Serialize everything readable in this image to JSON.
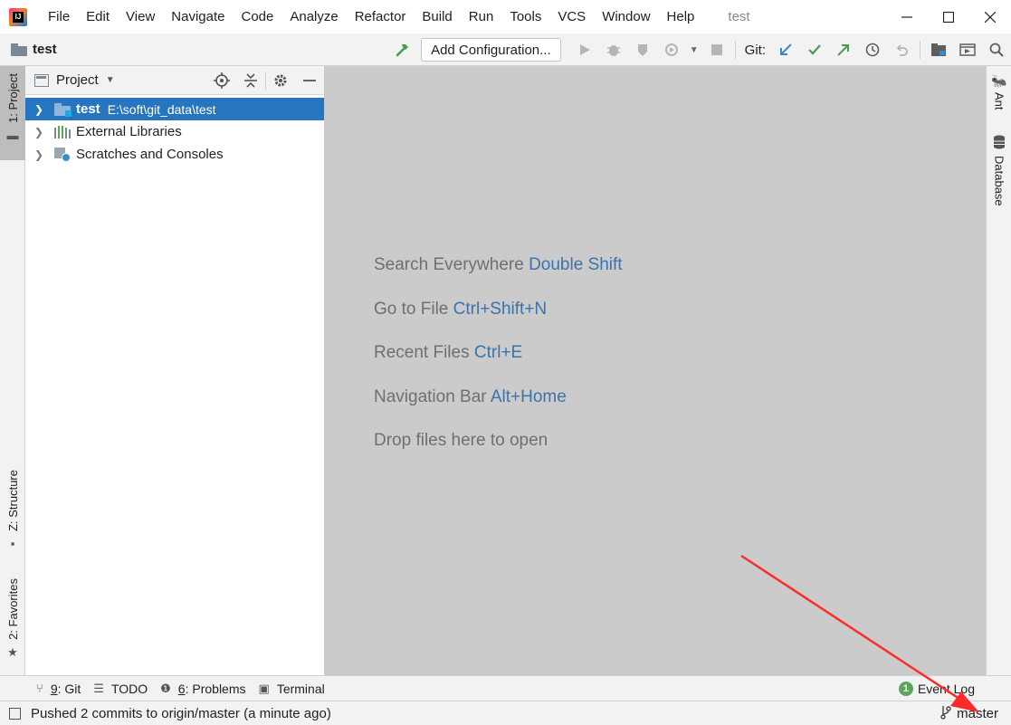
{
  "window": {
    "title": "test",
    "app_logo_text": "IJ",
    "controls": {
      "minimize": "–",
      "maximize": "☐",
      "close": "✕"
    }
  },
  "menu": {
    "file": "File",
    "edit": "Edit",
    "view": "View",
    "navigate": "Navigate",
    "code": "Code",
    "analyze": "Analyze",
    "refactor": "Refactor",
    "build": "Build",
    "run": "Run",
    "tools": "Tools",
    "vcs": "VCS",
    "window": "Window",
    "help": "Help"
  },
  "toolbar": {
    "breadcrumb": "test",
    "add_configuration": "Add Configuration...",
    "git_label": "Git:"
  },
  "left_strip": {
    "project_tab": "1: Project",
    "structure_tab": "Z: Structure",
    "favorites_tab": "2: Favorites"
  },
  "right_strip": {
    "ant_tab": "Ant",
    "database_tab": "Database"
  },
  "project_panel": {
    "title": "Project",
    "tree": [
      {
        "name": "test",
        "path": "E:\\soft\\git_data\\test",
        "selected": true
      },
      {
        "name": "External Libraries"
      },
      {
        "name": "Scratches and Consoles"
      }
    ]
  },
  "editor": {
    "hints": [
      {
        "text": "Search Everywhere",
        "key": "Double Shift"
      },
      {
        "text": "Go to File",
        "key": "Ctrl+Shift+N"
      },
      {
        "text": "Recent Files",
        "key": "Ctrl+E"
      },
      {
        "text": "Navigation Bar",
        "key": "Alt+Home"
      },
      {
        "text": "Drop files here to open",
        "key": ""
      }
    ]
  },
  "tool_windows": {
    "git": {
      "num": "9",
      "label": ": Git"
    },
    "todo": {
      "label": "TODO"
    },
    "problems": {
      "num": "6",
      "label": ": Problems"
    },
    "terminal": {
      "label": "Terminal"
    },
    "event_log": {
      "count": "1",
      "label": "Event Log"
    }
  },
  "status": {
    "message": "Pushed 2 commits to origin/master (a minute ago)",
    "branch": "master"
  },
  "colors": {
    "selection": "#2675bf",
    "editor_bg": "#cbcbcb",
    "shortcut": "#3b73aa",
    "annotation_arrow": "#ff2b2b"
  }
}
